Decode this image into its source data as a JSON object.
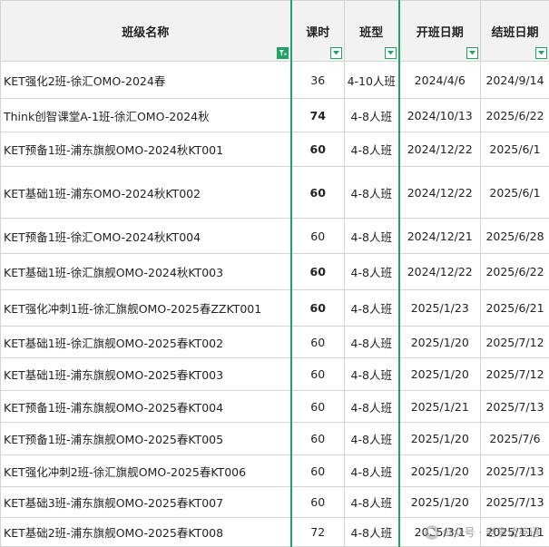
{
  "headers": [
    "班级名称",
    "课时",
    "班型",
    "开班日期",
    "结班日期"
  ],
  "rows": [
    {
      "name": "KET强化2班-徐汇OMO-2024春",
      "hours": "36",
      "bold": false,
      "type": "4-10人班",
      "start": "2024/4/6",
      "end": "2024/9/14",
      "h": 41
    },
    {
      "name": "Think创智课堂A-1班-徐汇OMO-2024秋",
      "hours": "74",
      "bold": true,
      "type": "4-8人班",
      "start": "2024/10/13",
      "end": "2025/6/22",
      "h": 37
    },
    {
      "name": "KET预备1班-浦东旗舰OMO-2024秋KT001",
      "hours": "60",
      "bold": true,
      "type": "4-8人班",
      "start": "2024/12/22",
      "end": "2025/6/1",
      "h": 38
    },
    {
      "name": "KET基础1班-浦东OMO-2024秋KT002",
      "hours": "60",
      "bold": true,
      "type": "4-8人班",
      "start": "2024/12/22",
      "end": "2025/6/1",
      "h": 57
    },
    {
      "name": "KET预备1班-徐汇OMO-2024秋KT004",
      "hours": "60",
      "bold": false,
      "type": "4-8人班",
      "start": "2024/12/21",
      "end": "2025/6/28",
      "h": 39
    },
    {
      "name": "KET基础1班-徐汇旗舰OMO-2024秋KT003",
      "hours": "60",
      "bold": true,
      "type": "4-8人班",
      "start": "2024/12/22",
      "end": "2025/6/22",
      "h": 40
    },
    {
      "name": "KET强化冲刺1班-徐汇旗舰OMO-2025春ZZKT001",
      "hours": "60",
      "bold": true,
      "type": "4-8人班",
      "start": "2025/1/23",
      "end": "2025/6/21",
      "h": 40
    },
    {
      "name": "KET基础1班-徐汇旗舰OMO-2025春KT002",
      "hours": "60",
      "bold": false,
      "type": "4-8人班",
      "start": "2025/1/20",
      "end": "2025/7/12",
      "h": 35
    },
    {
      "name": "KET基础1班-浦东旗舰OMO-2025春KT003",
      "hours": "60",
      "bold": false,
      "type": "4-8人班",
      "start": "2025/1/20",
      "end": "2025/7/12",
      "h": 36
    },
    {
      "name": "KET预备1班-浦东旗舰OMO-2025春KT004",
      "hours": "60",
      "bold": false,
      "type": "4-8人班",
      "start": "2025/1/21",
      "end": "2025/7/13",
      "h": 35
    },
    {
      "name": "KET预备1班-浦东旗舰OMO-2025春KT005",
      "hours": "60",
      "bold": false,
      "type": "4-8人班",
      "start": "2025/1/20",
      "end": "2025/7/6",
      "h": 36
    },
    {
      "name": "KET强化冲刺2班-徐汇旗舰OMO-2025春KT006",
      "hours": "60",
      "bold": false,
      "type": "4-8人班",
      "start": "2025/1/20",
      "end": "2025/7/13",
      "h": 35
    },
    {
      "name": "KET基础3班-浦东旗舰OMO-2025春KT007",
      "hours": "60",
      "bold": false,
      "type": "4-8人班",
      "start": "2025/1/20",
      "end": "2025/7/13",
      "h": 34
    },
    {
      "name": "KET基础2班-浦东旗舰OMO-2025春KT008",
      "hours": "72",
      "bold": false,
      "type": "4-8人班",
      "start": "2025/3/1",
      "end": "2025/11/1",
      "h": 32
    }
  ],
  "watermark": "公众号 · 老李谈英语",
  "colors": {
    "accent": "#21a366",
    "header_bg": "#f2f2f2",
    "grid": "#d4d4d4"
  }
}
